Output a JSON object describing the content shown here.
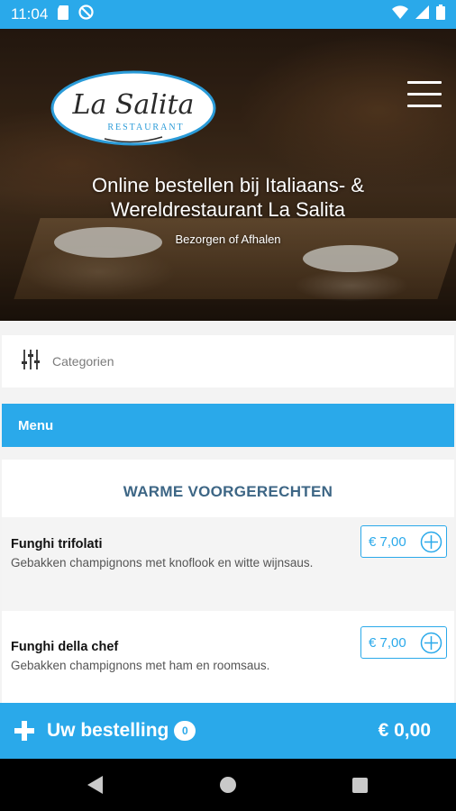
{
  "status_bar": {
    "time": "11:04",
    "icons_left": [
      "sd-card-icon",
      "data-saver-icon"
    ],
    "icons_right": [
      "wifi-icon",
      "signal-icon",
      "battery-icon"
    ]
  },
  "hero": {
    "logo_text": "La Salita",
    "logo_subtext": "RESTAURANT",
    "title_line1": "Online bestellen bij Italiaans- &",
    "title_line2": "Wereldrestaurant La Salita",
    "subtitle": "Bezorgen of Afhalen"
  },
  "categories": {
    "label": "Categorien",
    "icon": "sliders-icon"
  },
  "menu": {
    "header": "Menu",
    "section_title": "WARME VOORGERECHTEN",
    "items": [
      {
        "name": "Funghi trifolati",
        "description": "Gebakken champignons met knoflook en witte wijnsaus.",
        "price": "€ 7,00"
      },
      {
        "name": "Funghi della chef",
        "description": "Gebakken champignons met ham en roomsaus.",
        "price": "€ 7,00"
      }
    ]
  },
  "order_bar": {
    "label": "Uw bestelling",
    "count": "0",
    "total": "€ 0,00"
  },
  "colors": {
    "accent": "#2aa9ea",
    "section_title": "#3d6685",
    "logo_blue": "#2a9bd8"
  }
}
